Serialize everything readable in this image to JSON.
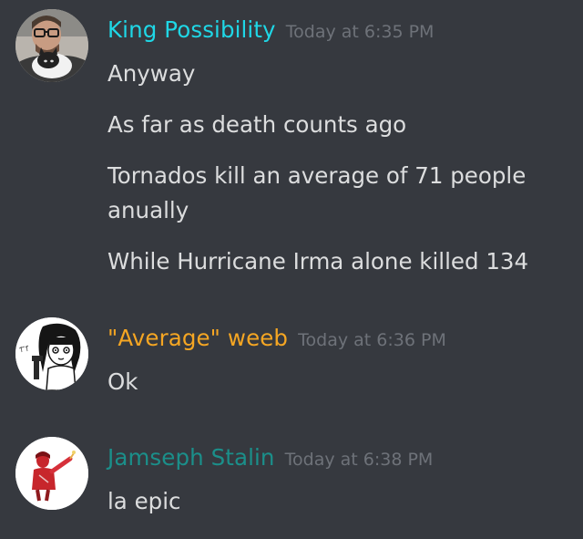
{
  "colors": {
    "background": "#36393f",
    "message_text": "#dcddde",
    "timestamp": "#6e7279"
  },
  "messages": [
    {
      "author": "King Possibility",
      "author_color": "#1fd7e6",
      "timestamp": "Today at 6:35 PM",
      "avatar_icon": "man-with-glasses-holding-cat-avatar",
      "lines": [
        "Anyway",
        "As far as death counts ago",
        "Tornados kill an average of 71 people",
        "anually",
        "While Hurricane Irma alone killed 134"
      ]
    },
    {
      "author": "\"Average\" weeb",
      "author_color": "#f5a623",
      "timestamp": "Today at 6:36 PM",
      "avatar_icon": "anime-girl-drawing-avatar",
      "lines": [
        "Ok"
      ]
    },
    {
      "author": "Jamseph Stalin",
      "author_color": "#1b8f8a",
      "timestamp": "Today at 6:38 PM",
      "avatar_icon": "red-figure-pointing-avatar",
      "lines": [
        "la epic"
      ]
    }
  ]
}
